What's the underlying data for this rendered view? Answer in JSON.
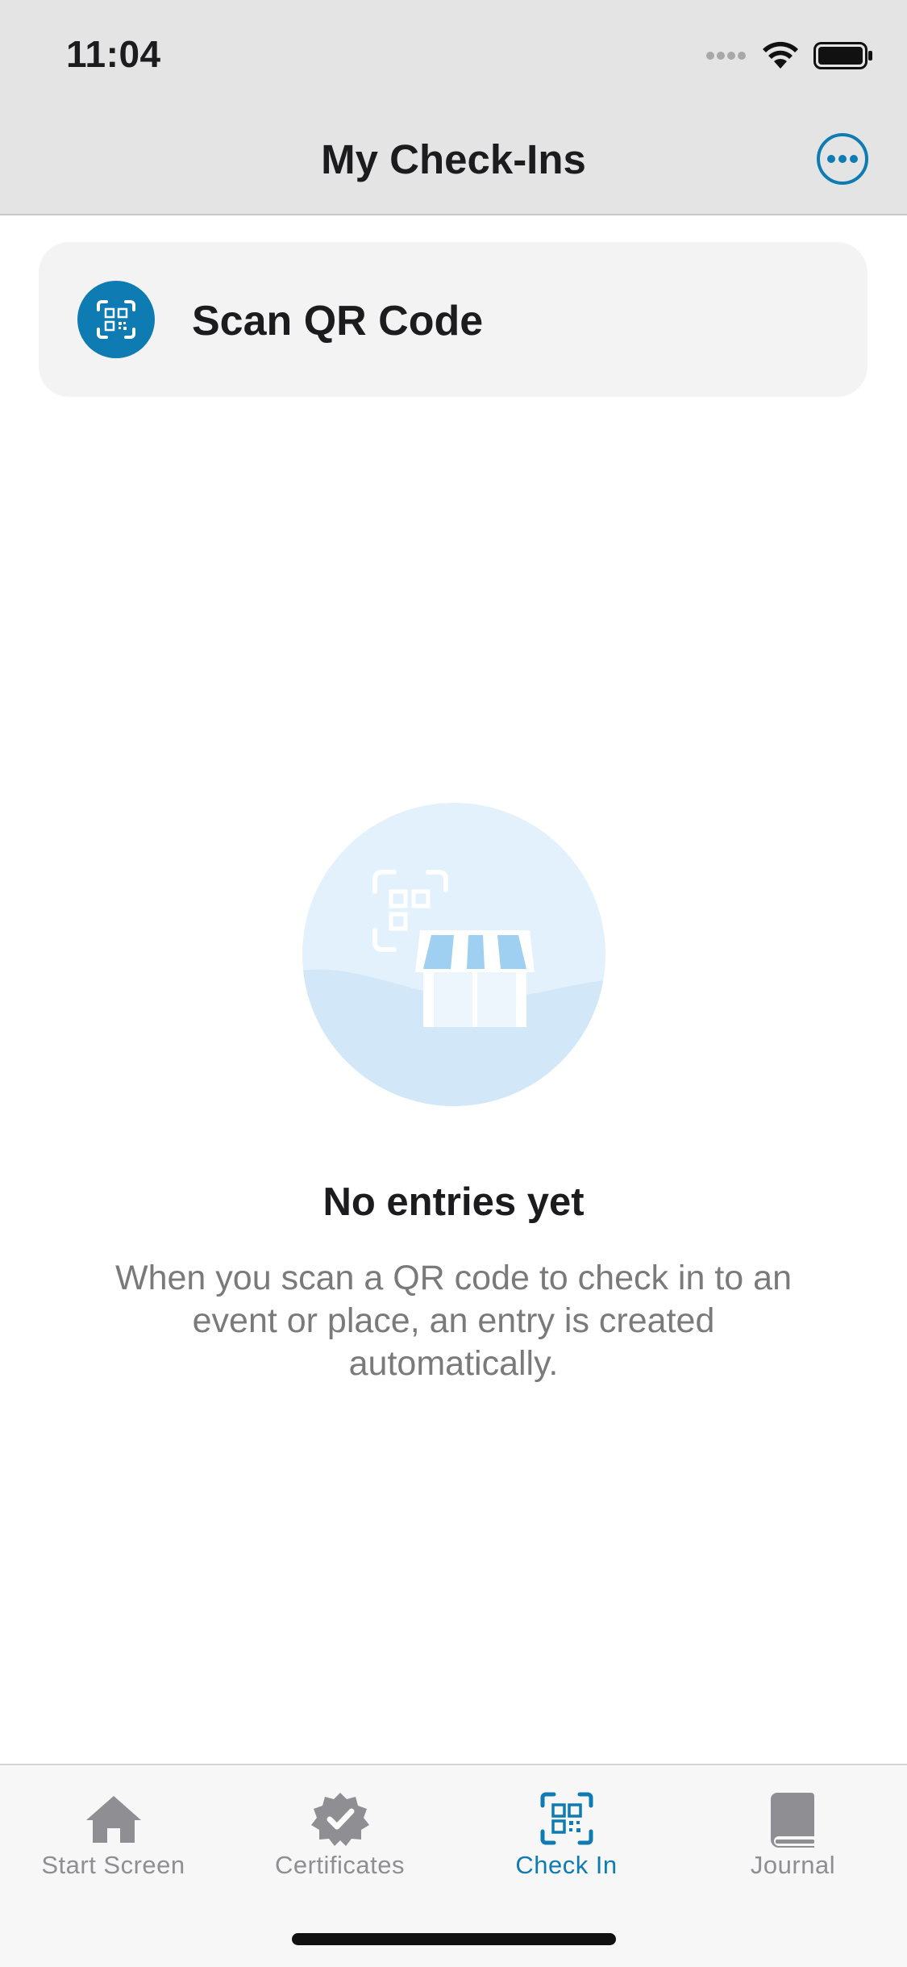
{
  "status_bar": {
    "time": "11:04"
  },
  "nav": {
    "title": "My Check-Ins",
    "more_icon": "ellipsis-circle-icon"
  },
  "scan_card": {
    "label": "Scan QR Code",
    "icon": "qr-scan-icon"
  },
  "empty_state": {
    "title": "No entries yet",
    "description": "When you scan a QR code to check in to an event or place, an entry is created automatically."
  },
  "tabs": [
    {
      "label": "Start Screen",
      "icon": "home-icon",
      "active": false
    },
    {
      "label": "Certificates",
      "icon": "certificate-badge-icon",
      "active": false
    },
    {
      "label": "Check In",
      "icon": "qr-scan-icon",
      "active": true
    },
    {
      "label": "Journal",
      "icon": "book-icon",
      "active": false
    }
  ],
  "colors": {
    "accent": "#0f7bb3",
    "inactive": "#8e8e93",
    "header_bg": "#e4e4e4",
    "card_bg": "#f3f3f3",
    "illustration_bg": "#e3f1fc"
  }
}
